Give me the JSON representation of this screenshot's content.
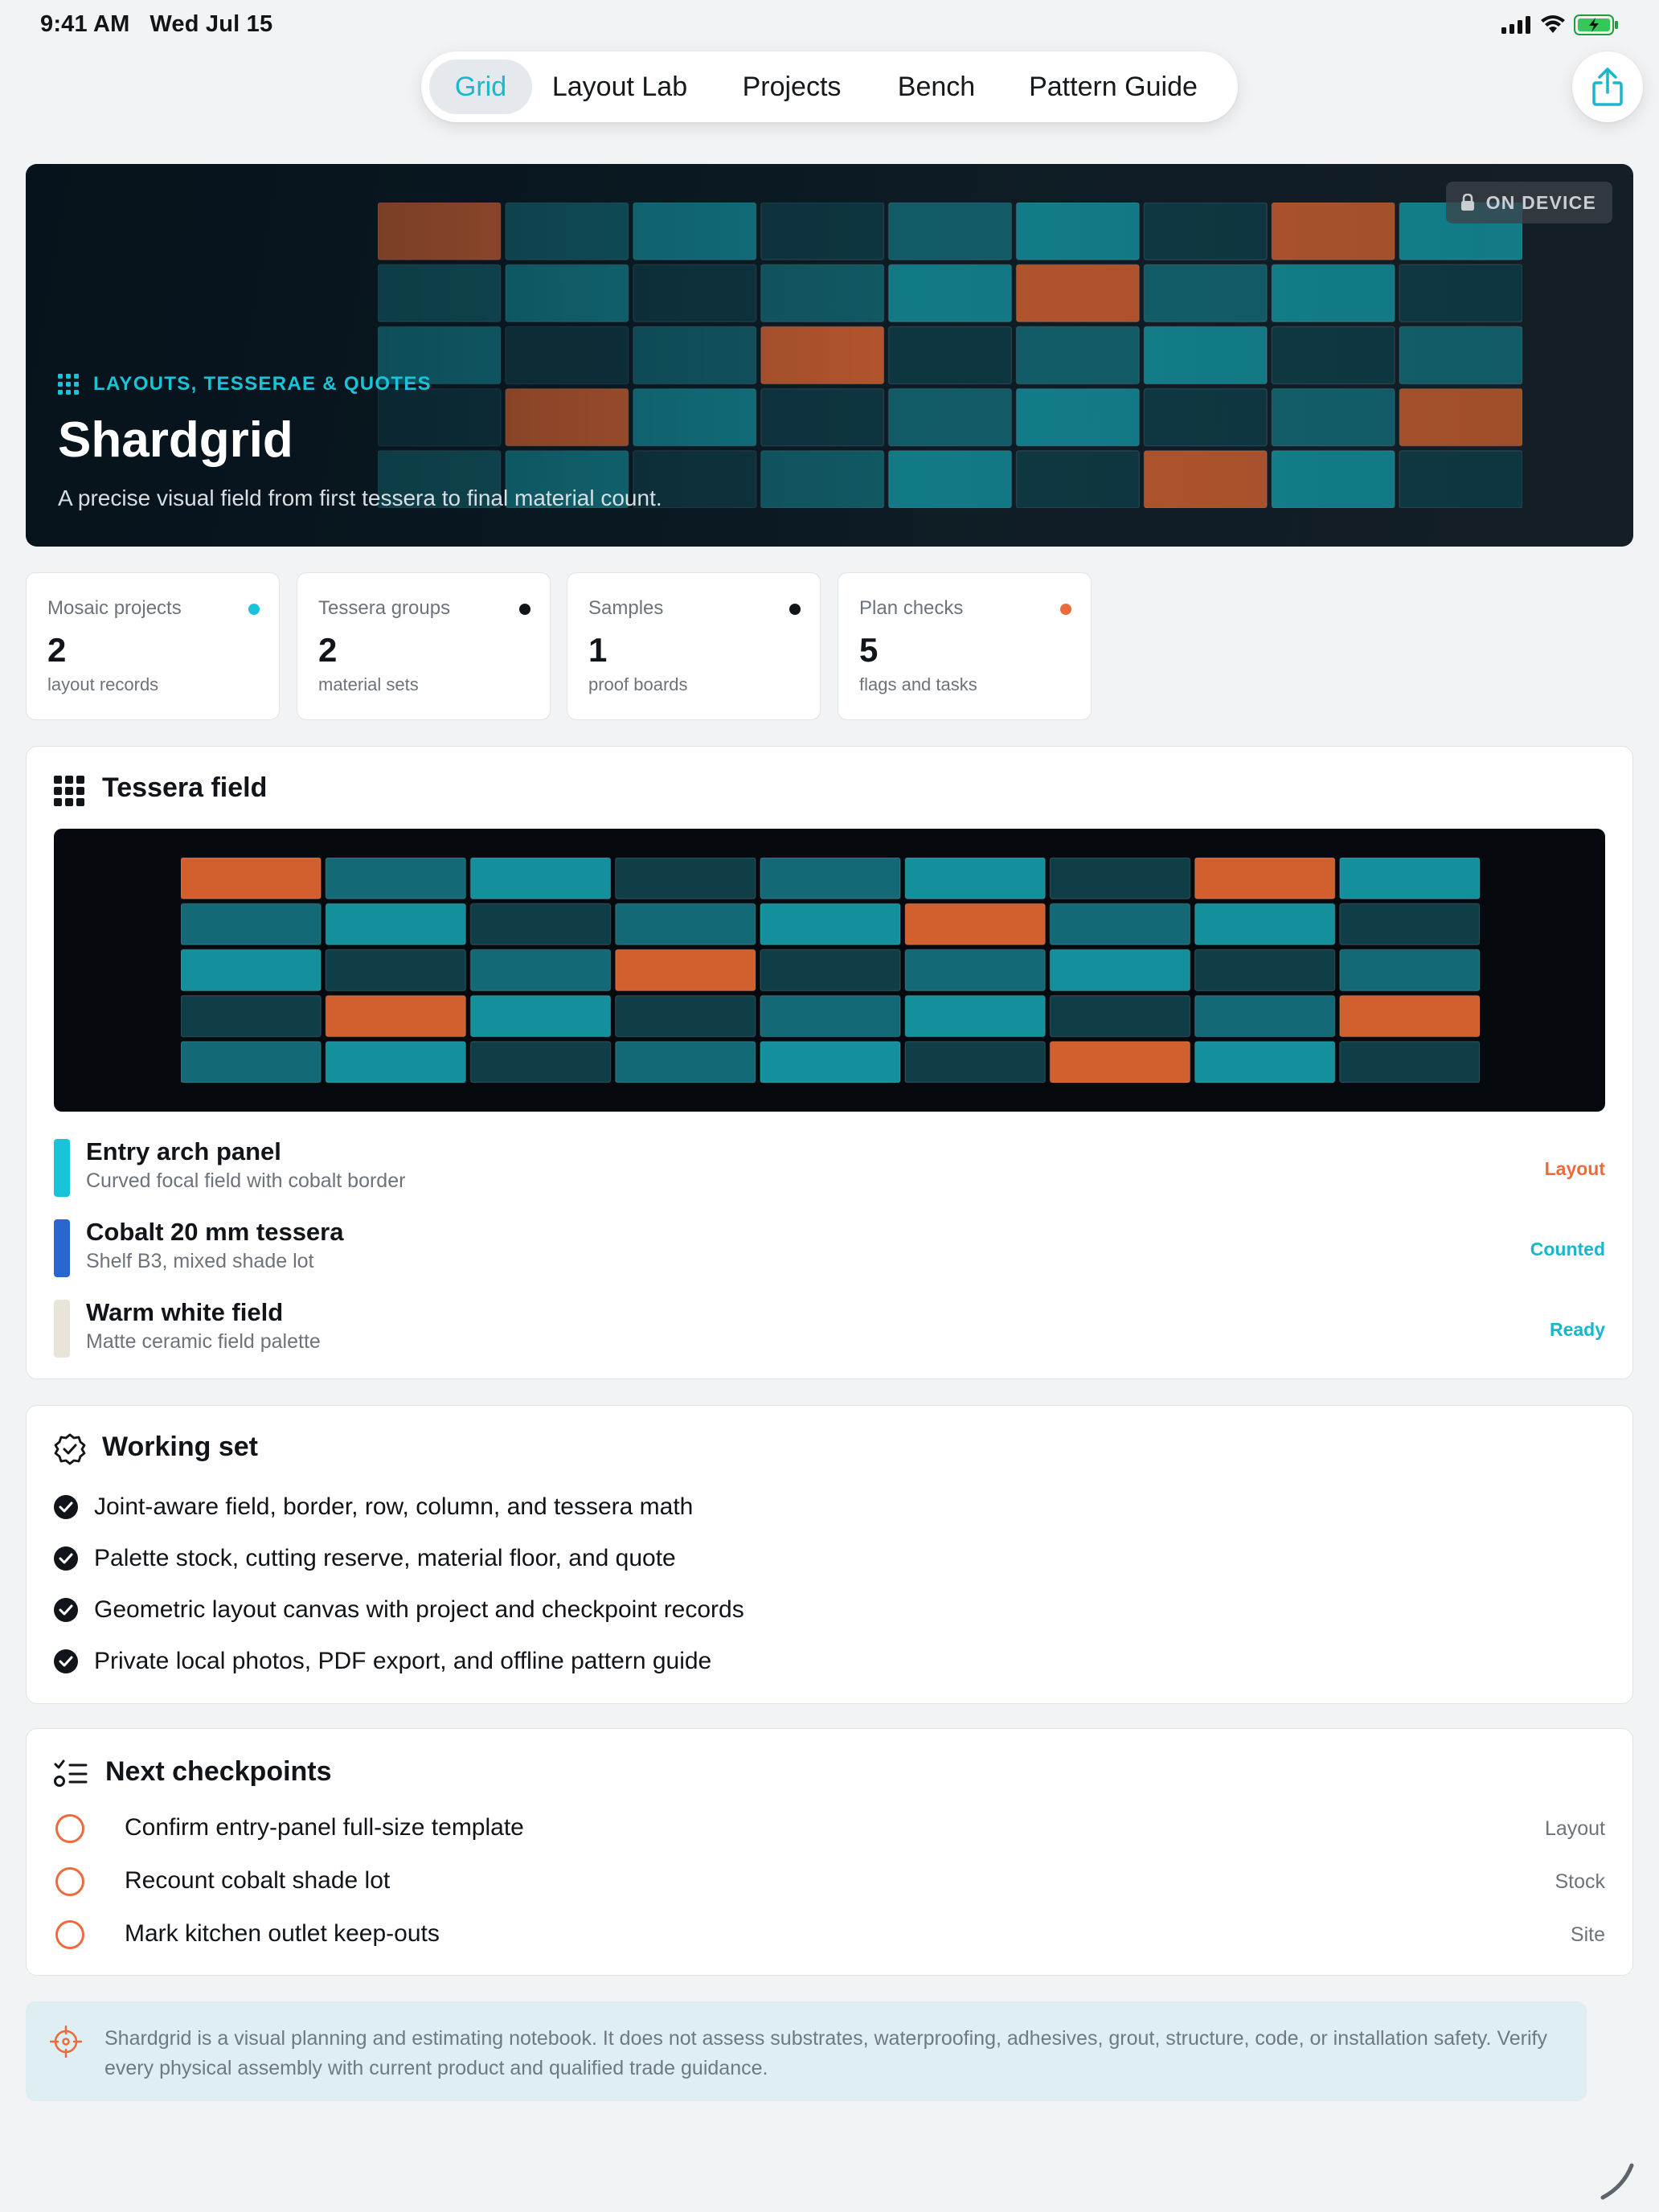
{
  "status_bar": {
    "time": "9:41 AM",
    "date": "Wed Jul 15"
  },
  "nav": {
    "tabs": [
      {
        "label": "Grid",
        "active": true
      },
      {
        "label": "Layout Lab",
        "active": false
      },
      {
        "label": "Projects",
        "active": false
      },
      {
        "label": "Bench",
        "active": false
      },
      {
        "label": "Pattern Guide",
        "active": false
      }
    ],
    "share_icon": "share-icon"
  },
  "hero": {
    "badge": "ON DEVICE",
    "eyebrow": "LAYOUTS, TESSERAE & QUOTES",
    "title": "Shardgrid",
    "subtitle": "A precise visual field from first tessera to final material count."
  },
  "stats": [
    {
      "label": "Mosaic projects",
      "value": "2",
      "sub": "layout records",
      "dot_color": "#19c3d9"
    },
    {
      "label": "Tessera groups",
      "value": "2",
      "sub": "material sets",
      "dot_color": "#111418"
    },
    {
      "label": "Samples",
      "value": "1",
      "sub": "proof boards",
      "dot_color": "#111418"
    },
    {
      "label": "Plan checks",
      "value": "5",
      "sub": "flags and tasks",
      "dot_color": "#ec6b3c"
    }
  ],
  "tessera_panel": {
    "title": "Tessera field",
    "materials": [
      {
        "title": "Entry arch panel",
        "sub": "Curved focal field with cobalt border",
        "tag": "Layout",
        "swatch": "#19c3d9",
        "tag_color": "#ec6b3c"
      },
      {
        "title": "Cobalt 20 mm tessera",
        "sub": "Shelf B3, mixed shade lot",
        "tag": "Counted",
        "swatch": "#2a66cf",
        "tag_color": "#19b6cc"
      },
      {
        "title": "Warm white field",
        "sub": "Matte ceramic field palette",
        "tag": "Ready",
        "swatch": "#e9e4d8",
        "tag_color": "#19b6cc"
      }
    ]
  },
  "working_set": {
    "title": "Working set",
    "items": [
      "Joint-aware field, border, row, column, and tessera math",
      "Palette stock, cutting reserve, material floor, and quote",
      "Geometric layout canvas with project and checkpoint records",
      "Private local photos, PDF export, and offline pattern guide"
    ]
  },
  "checkpoints": {
    "title": "Next checkpoints",
    "items": [
      {
        "text": "Confirm entry-panel full-size template",
        "tag": "Layout"
      },
      {
        "text": "Recount cobalt shade lot",
        "tag": "Stock"
      },
      {
        "text": "Mark kitchen outlet keep-outs",
        "tag": "Site"
      }
    ]
  },
  "notice": {
    "text": "Shardgrid is a visual planning and estimating notebook. It does not assess substrates, waterproofing, adhesives, grout, structure, code, or installation safety. Verify every physical assembly with current product and qualified trade guidance."
  },
  "colors": {
    "accent": "#19c3d9",
    "orange": "#ec6b3c",
    "tile_teal_bright": "#148f9c",
    "tile_teal_mid": "#136a76",
    "tile_teal_dark": "#0f3d48",
    "tile_orange": "#d2602f"
  },
  "tile_pattern": [
    [
      "o",
      "m",
      "b",
      "d",
      "m",
      "b",
      "d",
      "o",
      "b"
    ],
    [
      "m",
      "b",
      "d",
      "m",
      "b",
      "o",
      "m",
      "b",
      "d"
    ],
    [
      "b",
      "d",
      "m",
      "o",
      "d",
      "m",
      "b",
      "d",
      "m"
    ],
    [
      "d",
      "o",
      "b",
      "d",
      "m",
      "b",
      "d",
      "m",
      "o"
    ],
    [
      "m",
      "b",
      "d",
      "m",
      "b",
      "d",
      "o",
      "b",
      "d"
    ]
  ]
}
